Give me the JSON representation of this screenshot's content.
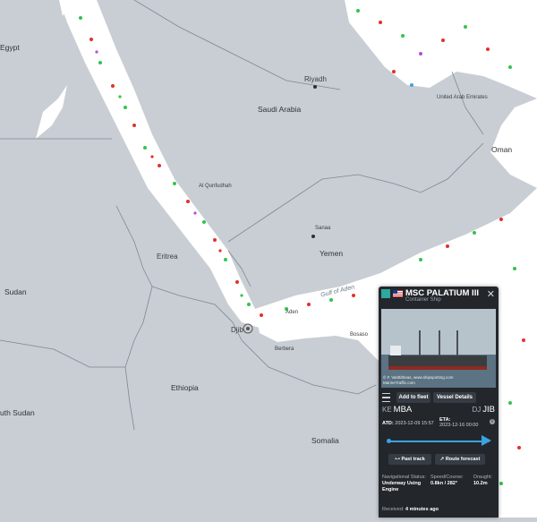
{
  "map": {
    "places": [
      {
        "id": "egypt",
        "label": "Egypt"
      },
      {
        "id": "saudi",
        "label": "Saudi Arabia"
      },
      {
        "id": "riyadh",
        "label": "Riyadh"
      },
      {
        "id": "oman",
        "label": "Oman"
      },
      {
        "id": "uae",
        "label": "United Arab Emirates"
      },
      {
        "id": "yemen",
        "label": "Yemen"
      },
      {
        "id": "eritrea",
        "label": "Eritrea"
      },
      {
        "id": "sudan",
        "label": "Sudan"
      },
      {
        "id": "ethiopia",
        "label": "Ethiopia"
      },
      {
        "id": "southsudan",
        "label": "uth Sudan"
      },
      {
        "id": "somalia",
        "label": "Somalia"
      },
      {
        "id": "djibouti",
        "label": "Djib"
      },
      {
        "id": "aden",
        "label": "Aden"
      },
      {
        "id": "gulf",
        "label": "Gulf of Aden"
      },
      {
        "id": "bosaso",
        "label": "Bosaso"
      },
      {
        "id": "berbera",
        "label": "Berbera"
      },
      {
        "id": "sanaa",
        "label": "Sanaa"
      },
      {
        "id": "alqunfudhah",
        "label": "Al Qunfudhah"
      }
    ]
  },
  "panel": {
    "vessel_name": "MSC PALATIUM III",
    "vessel_type": "Container Ship",
    "photo_credit": "© F. Varittitheas, www.shipspotting.com\nMarineTraffic.com",
    "add_to_fleet": "Add to fleet",
    "vessel_details": "Vessel Details",
    "origin_cc": "KE",
    "origin_port": "MBA",
    "dest_cc": "DJ",
    "dest_port": "JIB",
    "atd_label": "ATD:",
    "atd_value": "2023-12-09 15:57",
    "eta_label": "ETA:",
    "eta_value": "2023-12-16 00:00",
    "progress": 0.93,
    "past_track": "Past track",
    "route_forecast": "Route forecast",
    "nav_status_label": "Navigational Status:",
    "nav_status_value": "Underway Using Engine",
    "speed_label": "Speed/Course:",
    "speed_value": "0.8kn / 282°",
    "draught_label": "Draught:",
    "draught_value": "10.2m",
    "received_label": "Received:",
    "received_value": "4 minutes ago"
  },
  "colors": {
    "land": "#c9ced4",
    "sea": "#ffffff",
    "panel": "#23272c",
    "accent": "#3aa3e3",
    "vessel_green": "#31c44e",
    "vessel_red": "#e2312b"
  }
}
